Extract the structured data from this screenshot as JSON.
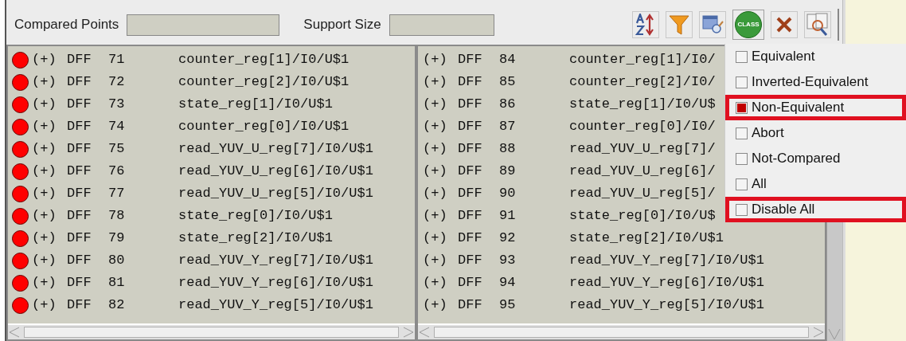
{
  "toolbar": {
    "fields": [
      {
        "label": "Compared Points"
      },
      {
        "label": "Support Size"
      }
    ],
    "buttons": [
      {
        "kind": "sort"
      },
      {
        "kind": "filter"
      },
      {
        "kind": "inspect"
      },
      {
        "kind": "class",
        "label": "CLASS"
      },
      {
        "kind": "delete"
      },
      {
        "kind": "search"
      }
    ]
  },
  "lists": [
    {
      "rows": [
        {
          "color": "#ff0000",
          "sign": "(+)",
          "type": "DFF",
          "id": "71",
          "name": "counter_reg[1]/I0/U$1"
        },
        {
          "color": "#ff0000",
          "sign": "(+)",
          "type": "DFF",
          "id": "72",
          "name": "counter_reg[2]/I0/U$1"
        },
        {
          "color": "#ff0000",
          "sign": "(+)",
          "type": "DFF",
          "id": "73",
          "name": "state_reg[1]/I0/U$1"
        },
        {
          "color": "#ff0000",
          "sign": "(+)",
          "type": "DFF",
          "id": "74",
          "name": "counter_reg[0]/I0/U$1"
        },
        {
          "color": "#ff0000",
          "sign": "(+)",
          "type": "DFF",
          "id": "75",
          "name": "read_YUV_U_reg[7]/I0/U$1"
        },
        {
          "color": "#ff0000",
          "sign": "(+)",
          "type": "DFF",
          "id": "76",
          "name": "read_YUV_U_reg[6]/I0/U$1"
        },
        {
          "color": "#ff0000",
          "sign": "(+)",
          "type": "DFF",
          "id": "77",
          "name": "read_YUV_U_reg[5]/I0/U$1"
        },
        {
          "color": "#ff0000",
          "sign": "(+)",
          "type": "DFF",
          "id": "78",
          "name": "state_reg[0]/I0/U$1"
        },
        {
          "color": "#ff0000",
          "sign": "(+)",
          "type": "DFF",
          "id": "79",
          "name": "state_reg[2]/I0/U$1"
        },
        {
          "color": "#ff0000",
          "sign": "(+)",
          "type": "DFF",
          "id": "80",
          "name": "read_YUV_Y_reg[7]/I0/U$1"
        },
        {
          "color": "#ff0000",
          "sign": "(+)",
          "type": "DFF",
          "id": "81",
          "name": "read_YUV_Y_reg[6]/I0/U$1"
        },
        {
          "color": "#ff0000",
          "sign": "(+)",
          "type": "DFF",
          "id": "82",
          "name": "read_YUV_Y_reg[5]/I0/U$1"
        }
      ]
    },
    {
      "rows": [
        {
          "sign": "(+)",
          "type": "DFF",
          "id": "84",
          "name": "counter_reg[1]/I0/"
        },
        {
          "sign": "(+)",
          "type": "DFF",
          "id": "85",
          "name": "counter_reg[2]/I0/"
        },
        {
          "sign": "(+)",
          "type": "DFF",
          "id": "86",
          "name": "state_reg[1]/I0/U$"
        },
        {
          "sign": "(+)",
          "type": "DFF",
          "id": "87",
          "name": "counter_reg[0]/I0/"
        },
        {
          "sign": "(+)",
          "type": "DFF",
          "id": "88",
          "name": "read_YUV_U_reg[7]/"
        },
        {
          "sign": "(+)",
          "type": "DFF",
          "id": "89",
          "name": "read_YUV_U_reg[6]/"
        },
        {
          "sign": "(+)",
          "type": "DFF",
          "id": "90",
          "name": "read_YUV_U_reg[5]/"
        },
        {
          "sign": "(+)",
          "type": "DFF",
          "id": "91",
          "name": "state_reg[0]/I0/U$"
        },
        {
          "sign": "(+)",
          "type": "DFF",
          "id": "92",
          "name": "state_reg[2]/I0/U$1"
        },
        {
          "sign": "(+)",
          "type": "DFF",
          "id": "93",
          "name": "read_YUV_Y_reg[7]/I0/U$1"
        },
        {
          "sign": "(+)",
          "type": "DFF",
          "id": "94",
          "name": "read_YUV_Y_reg[6]/I0/U$1"
        },
        {
          "sign": "(+)",
          "type": "DFF",
          "id": "95",
          "name": "read_YUV_Y_reg[5]/I0/U$1"
        }
      ]
    }
  ],
  "filter_menu": {
    "items": [
      {
        "label": "Equivalent",
        "checked": false,
        "highlighted": false
      },
      {
        "label": "Inverted-Equivalent",
        "checked": false,
        "highlighted": false
      },
      {
        "label": "Non-Equivalent",
        "checked": true,
        "highlighted": true
      },
      {
        "label": "Abort",
        "checked": false,
        "highlighted": false
      },
      {
        "label": "Not-Compared",
        "checked": false,
        "highlighted": false
      },
      {
        "label": "All",
        "checked": false,
        "highlighted": false
      },
      {
        "label": "Disable All",
        "checked": false,
        "highlighted": true
      }
    ]
  }
}
